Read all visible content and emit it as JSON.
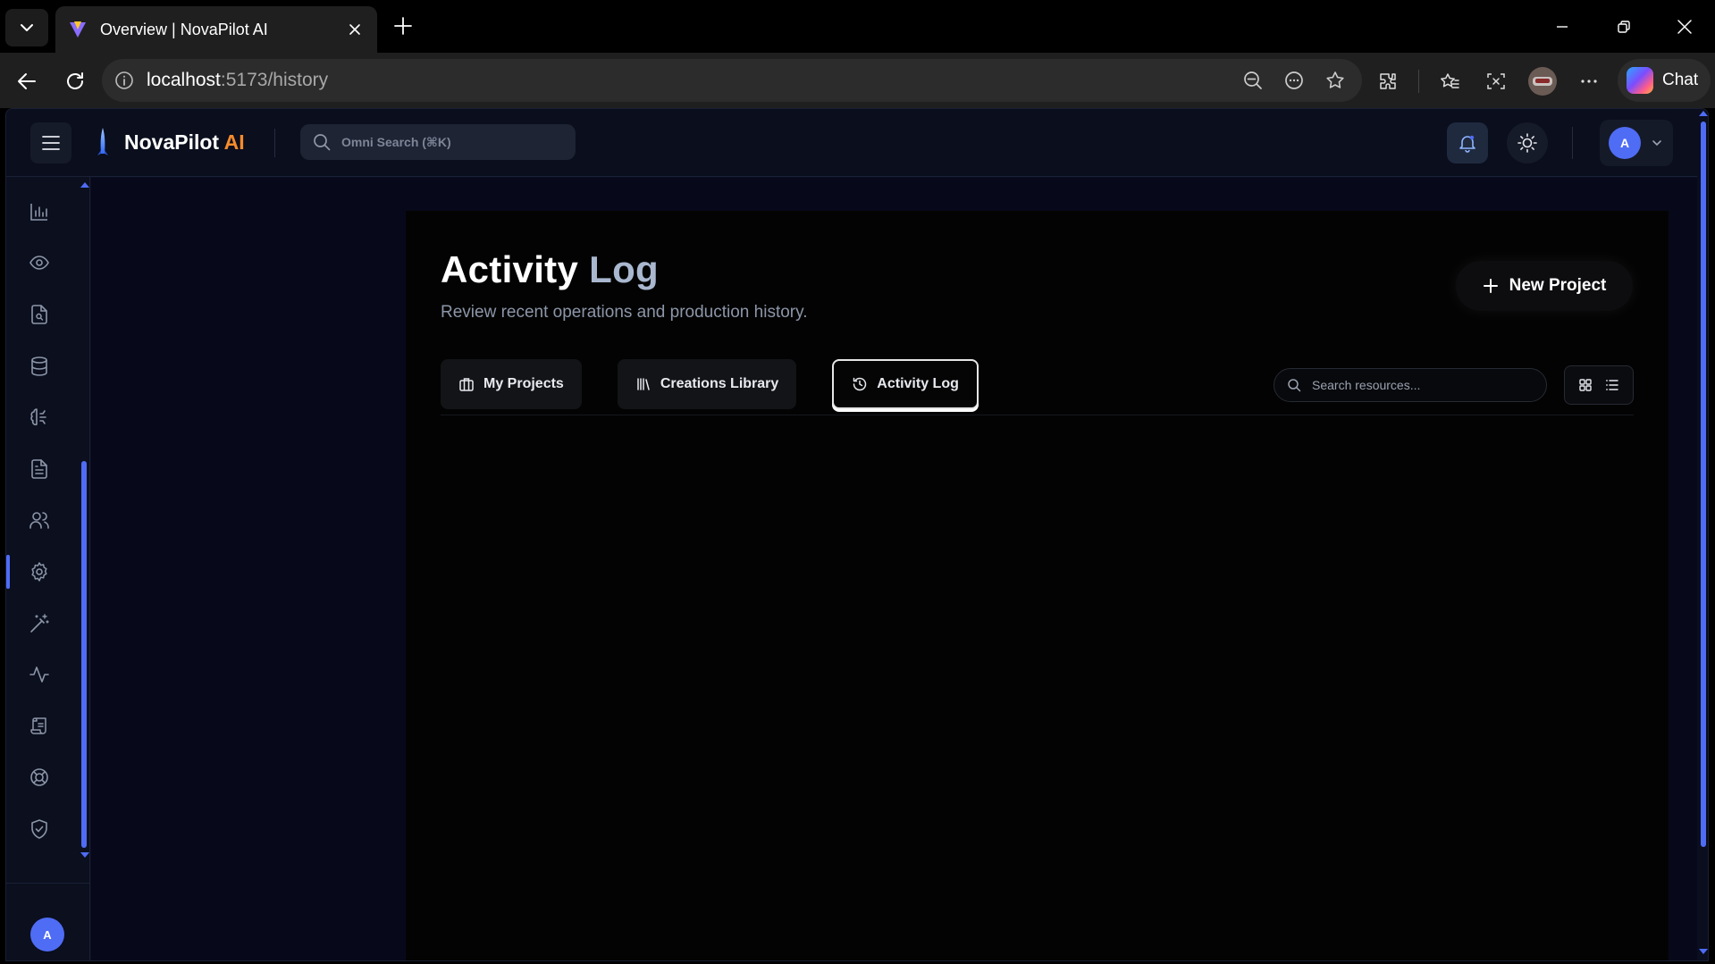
{
  "browser": {
    "tab_title": "Overview | NovaPilot AI",
    "url_host": "localhost",
    "url_rest": ":5173/history",
    "chat_label": "Chat"
  },
  "app": {
    "brand_name": "NovaPilot",
    "brand_suffix": "AI",
    "omni_search_placeholder": "Omni Search (⌘K)",
    "user_initial": "A",
    "colors": {
      "accent": "#4f6cf5",
      "brand_suffix": "#f58b2c",
      "background": "#07091a"
    }
  },
  "sidebar": {
    "items": [
      {
        "name": "analytics",
        "icon": "bar-chart-icon"
      },
      {
        "name": "overview",
        "icon": "eye-icon"
      },
      {
        "name": "document-search",
        "icon": "file-search-icon"
      },
      {
        "name": "database",
        "icon": "database-icon"
      },
      {
        "name": "models",
        "icon": "brain-icon"
      },
      {
        "name": "documents",
        "icon": "file-text-icon"
      },
      {
        "name": "users",
        "icon": "users-icon"
      },
      {
        "name": "settings",
        "icon": "gear-icon",
        "active": true
      },
      {
        "name": "magic",
        "icon": "wand-icon"
      },
      {
        "name": "activity",
        "icon": "pulse-icon"
      },
      {
        "name": "scroll",
        "icon": "scroll-icon"
      },
      {
        "name": "support",
        "icon": "lifebuoy-icon"
      },
      {
        "name": "security",
        "icon": "shield-check-icon"
      }
    ],
    "user_initial": "A"
  },
  "page": {
    "title_main": "Activity",
    "title_accent": "Log",
    "subtitle": "Review recent operations and production history.",
    "new_project_label": "New Project",
    "tabs": [
      {
        "label": "My Projects",
        "icon": "briefcase-icon"
      },
      {
        "label": "Creations Library",
        "icon": "library-icon"
      },
      {
        "label": "Activity Log",
        "icon": "history-icon",
        "active": true
      }
    ],
    "search_placeholder": "Search resources..."
  }
}
